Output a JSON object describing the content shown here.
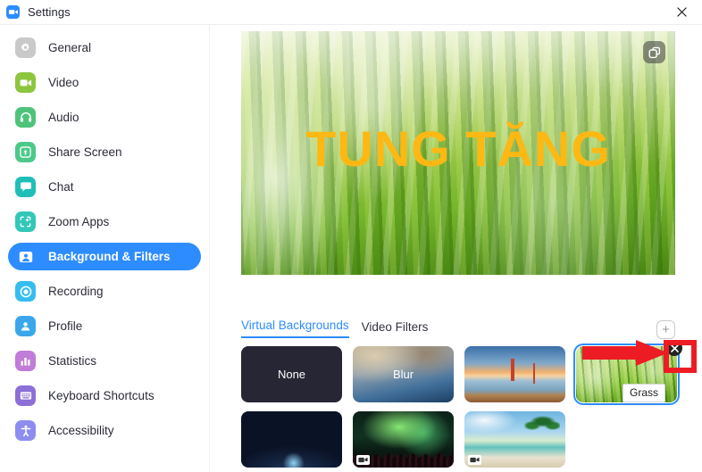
{
  "window": {
    "title": "Settings",
    "logo_icon": "zoom-logo-icon",
    "close_icon": "close-icon"
  },
  "sidebar": {
    "items": [
      {
        "label": "General",
        "icon": "gear-icon",
        "color": "#c9c9c9",
        "active": false
      },
      {
        "label": "Video",
        "icon": "video-icon",
        "color": "#8cc63f",
        "active": false
      },
      {
        "label": "Audio",
        "icon": "headset-icon",
        "color": "#4ec37a",
        "active": false
      },
      {
        "label": "Share Screen",
        "icon": "upload-icon",
        "color": "#4cc98a",
        "active": false
      },
      {
        "label": "Chat",
        "icon": "chat-icon",
        "color": "#1fbfb8",
        "active": false
      },
      {
        "label": "Zoom Apps",
        "icon": "apps-icon",
        "color": "#33c7b8",
        "active": false
      },
      {
        "label": "Background & Filters",
        "icon": "person-icon",
        "color": "#2D8CFF",
        "active": true
      },
      {
        "label": "Recording",
        "icon": "record-icon",
        "color": "#36bdf0",
        "active": false
      },
      {
        "label": "Profile",
        "icon": "profile-icon",
        "color": "#3aa7ec",
        "active": false
      },
      {
        "label": "Statistics",
        "icon": "bars-icon",
        "color": "#c07cd8",
        "active": false
      },
      {
        "label": "Keyboard Shortcuts",
        "icon": "keyboard-icon",
        "color": "#8d6fd8",
        "active": false
      },
      {
        "label": "Accessibility",
        "icon": "accessibility-icon",
        "color": "#8d8df0",
        "active": false
      }
    ]
  },
  "preview": {
    "overlay_text": "TUNG TĂNG",
    "overlay_color": "#FDB813",
    "capture_button_icon": "snapshot-icon"
  },
  "tabs": [
    {
      "label": "Virtual Backgrounds",
      "active": true
    },
    {
      "label": "Video Filters",
      "active": false
    }
  ],
  "add_button": {
    "label": "+",
    "icon": "plus-icon"
  },
  "backgrounds": [
    {
      "name": "None",
      "style": "th-none",
      "label": "None",
      "video": false,
      "selected": false
    },
    {
      "name": "Blur",
      "style": "th-blur",
      "label": "Blur",
      "video": false,
      "selected": false
    },
    {
      "name": "Golden Gate Bridge",
      "style": "th-bridge",
      "label": "",
      "video": false,
      "selected": false
    },
    {
      "name": "Grass",
      "style": "th-grass",
      "label": "",
      "video": false,
      "selected": true,
      "tooltip": "Grass"
    },
    {
      "name": "Earth",
      "style": "th-earth",
      "label": "",
      "video": false,
      "selected": false
    },
    {
      "name": "Aurora",
      "style": "th-aurora",
      "label": "",
      "video": true,
      "selected": false
    },
    {
      "name": "Beach",
      "style": "th-beach",
      "label": "",
      "video": true,
      "selected": false
    }
  ],
  "annotations": {
    "arrow_color": "#ED1C24",
    "rect_color": "#ED1C24",
    "delete_badge_icon": "close-circle-icon",
    "tooltip_text": "Grass"
  },
  "colors": {
    "accent": "#2D8CFF",
    "overlay_text": "#FDB813",
    "annotation_red": "#ED1C24"
  }
}
